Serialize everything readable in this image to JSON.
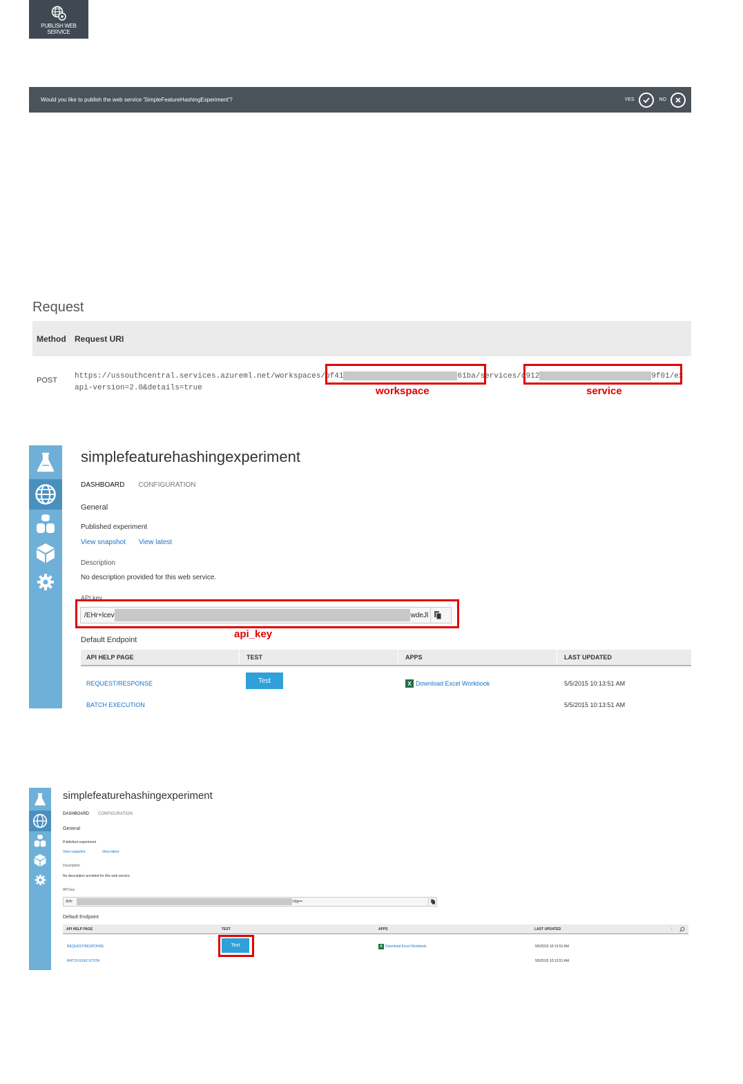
{
  "publish_button": {
    "label": "PUBLISH WEB SERVICE",
    "icon": "globe-gear-icon"
  },
  "confirm_bar": {
    "question": "Would you like to publish the web service 'SimpleFeatureHashingExperiment'?",
    "yes_label": "YES",
    "no_label": "NO"
  },
  "request": {
    "title": "Request",
    "headers": [
      "Method",
      "Request URI"
    ],
    "method": "POST",
    "uri_prefix": "https://ussouthcentral.services.azureml.net/workspaces/",
    "ws_start": "bf41",
    "ws_end": "61ba",
    "services_segment": "/services/",
    "svc_start": "c912",
    "svc_end": "9f01",
    "uri_tail": "/ex",
    "uri_line2": "api-version=2.0&details=true",
    "annotations": {
      "workspace": "workspace",
      "service": "service"
    }
  },
  "dashboard": {
    "title": "simplefeaturehashingexperiment",
    "tabs": [
      "DASHBOARD",
      "CONFIGURATION"
    ],
    "general_label": "General",
    "published_label": "Published experiment",
    "view_snapshot": "View snapshot",
    "view_latest": "View latest",
    "description_label": "Description",
    "description": "No description provided for this web service.",
    "api_key_label": "API key",
    "api_key_start_large": "/EHr+lcev",
    "api_key_end_large": "wdeJl",
    "api_key_start_small": "/EHr",
    "api_key_end_small": "h2g==",
    "api_key_annotation": "api_key",
    "default_endpoint": "Default Endpoint",
    "columns": [
      "API HELP PAGE",
      "TEST",
      "APPS",
      "LAST UPDATED"
    ],
    "rows": [
      {
        "help_page": "REQUEST/RESPONSE",
        "test": "Test",
        "apps": "Download Excel Workbook",
        "updated": "5/5/2015 10:13:51 AM"
      },
      {
        "help_page": "BATCH EXECUTION",
        "test": "",
        "apps": "",
        "updated": "5/5/2015 10:13:51 AM"
      }
    ],
    "sidebar_icons": [
      "flask-icon",
      "globe-icon",
      "datasets-icon",
      "cube-icon",
      "gear-icon"
    ]
  },
  "colors": {
    "sidebar": "#6fb0d8",
    "sidebar_active": "#4a90bf",
    "accent_blue": "#2fa0da",
    "link_blue": "#1a72c8",
    "annotation_red": "#e00000",
    "dark_bar": "#4a525a"
  }
}
